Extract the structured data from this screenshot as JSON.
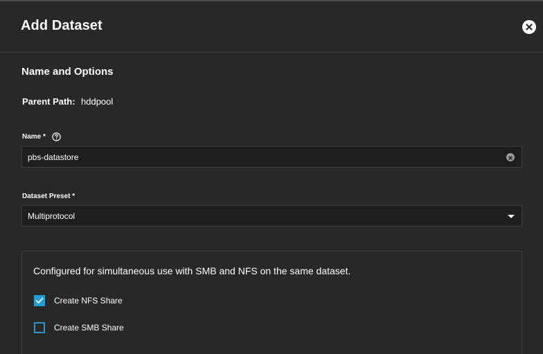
{
  "header": {
    "title": "Add Dataset"
  },
  "section": {
    "title": "Name and Options"
  },
  "parent_path": {
    "label": "Parent Path:",
    "value": "hddpool"
  },
  "name_field": {
    "label": "Name *",
    "value": "pbs-datastore"
  },
  "preset_field": {
    "label": "Dataset Preset *",
    "value": "Multiprotocol"
  },
  "config": {
    "description": "Configured for simultaneous use with SMB and NFS on the same dataset.",
    "checkboxes": [
      {
        "label": "Create NFS Share",
        "checked": true
      },
      {
        "label": "Create SMB Share",
        "checked": false
      }
    ]
  },
  "colors": {
    "background": "#282828",
    "input_background": "#1e1e1e",
    "accent": "#1ea0d8"
  },
  "icons": [
    "close-icon",
    "help-icon",
    "clear-icon",
    "chevron-down-icon",
    "check-icon"
  ]
}
